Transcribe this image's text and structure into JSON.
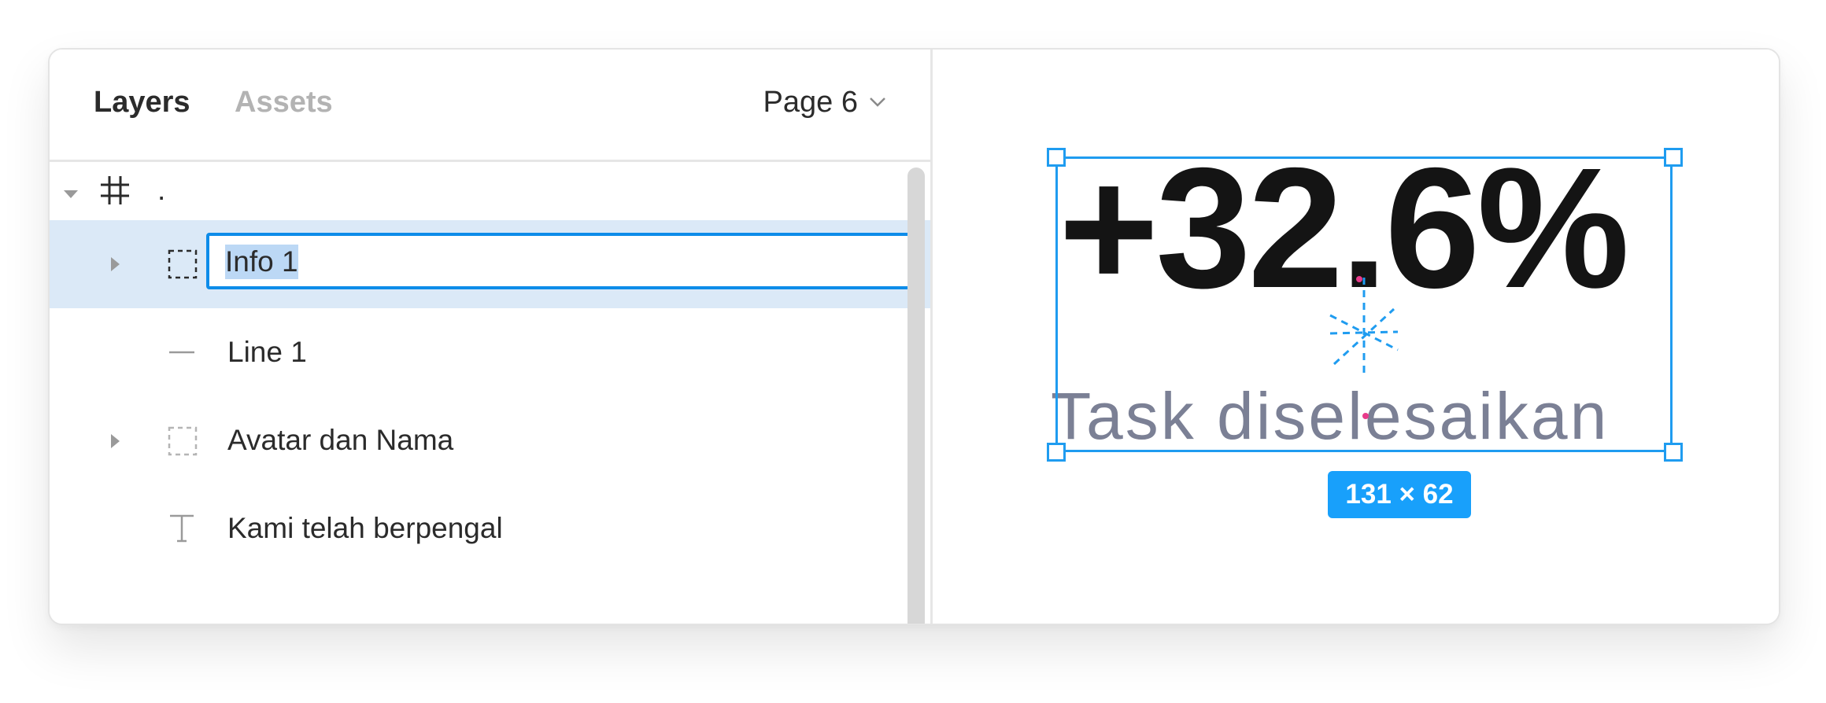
{
  "panel": {
    "tabs": [
      {
        "label": "Layers",
        "active": true
      },
      {
        "label": "Assets",
        "active": false
      }
    ],
    "page_select": {
      "label": "Page 6",
      "icon": "chevron-down-icon"
    }
  },
  "layers": [
    {
      "label": ".",
      "icon": "frame-icon",
      "expand": "expanded"
    },
    {
      "label": "Info 1",
      "icon": "group-icon",
      "expand": "collapsed",
      "selected": true,
      "editing": true
    },
    {
      "label": "Line 1",
      "icon": "line-icon"
    },
    {
      "label": "Avatar dan Nama",
      "icon": "group-icon",
      "expand": "collapsed"
    },
    {
      "label": "Kami telah berpengal",
      "icon": "text-icon"
    }
  ],
  "canvas": {
    "number_text": "+32.6%",
    "caption_text": "Task diselesaikan",
    "size_badge": "131 × 62"
  },
  "colors": {
    "selection_blue": "#18a0fb",
    "selected_row": "#dbe9f7",
    "caption_gray": "#7b8095"
  }
}
